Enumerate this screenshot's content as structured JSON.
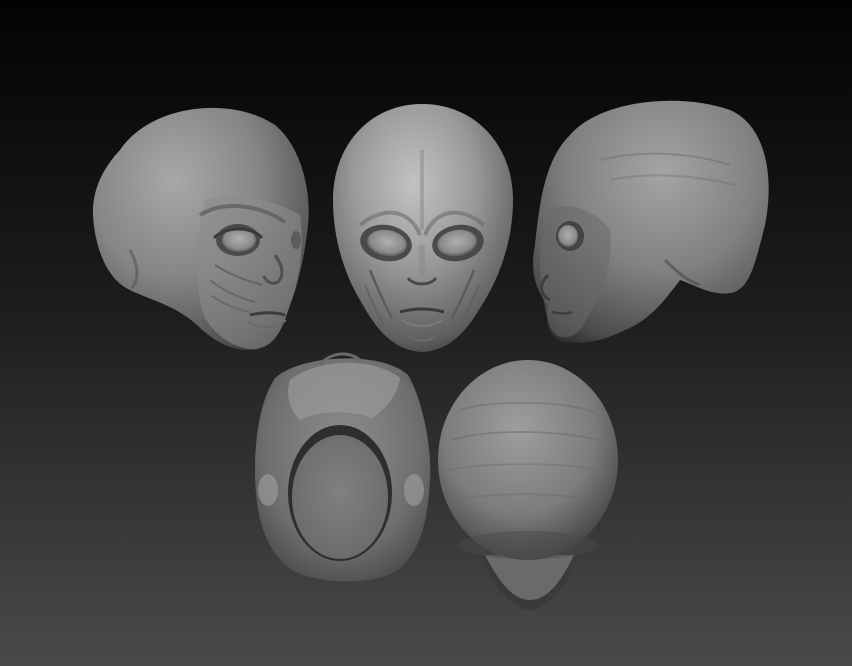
{
  "scene": {
    "views": [
      {
        "name": "three-quarter-left",
        "icon": "head-three-quarter-left-icon"
      },
      {
        "name": "front",
        "icon": "head-front-icon"
      },
      {
        "name": "side-right",
        "icon": "head-side-right-icon"
      },
      {
        "name": "bottom",
        "icon": "head-bottom-icon"
      },
      {
        "name": "top",
        "icon": "head-top-icon"
      }
    ],
    "colors": {
      "background_top": "#030303",
      "background_bottom": "#4a4a4a",
      "clay_light": "#b4b4b4",
      "clay_mid": "#8a8a8a",
      "clay_dark": "#3e3e3e"
    }
  }
}
